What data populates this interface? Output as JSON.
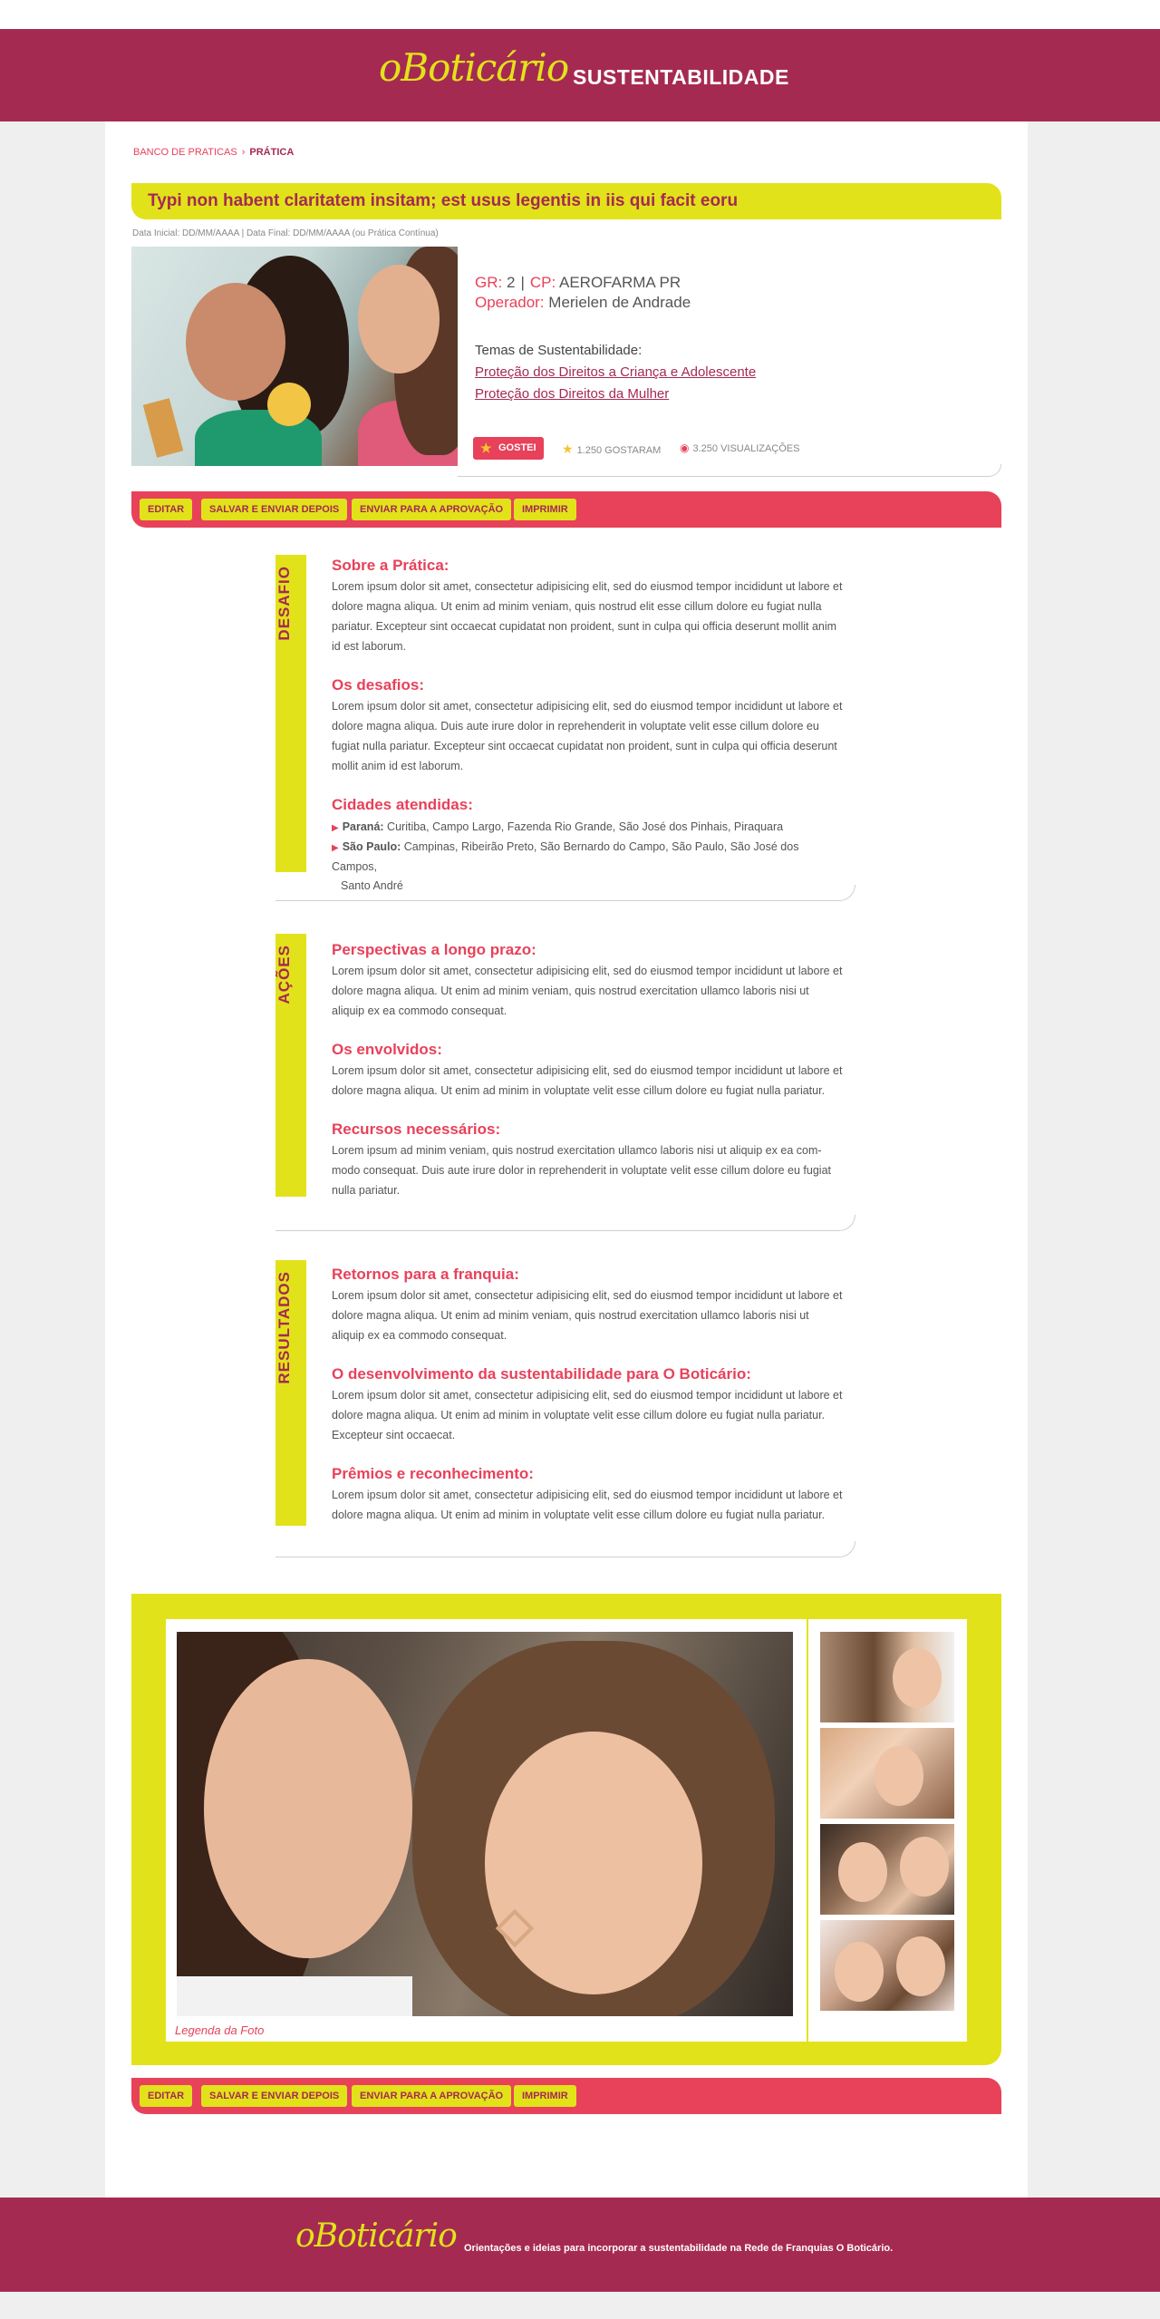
{
  "header": {
    "logo": "oBoticário",
    "title": "SUSTENTABILIDADE"
  },
  "breadcrumb": {
    "root": "BANCO DE PRATICAS",
    "separator": "›",
    "current": "PRÁTICA"
  },
  "practice": {
    "title": "Typi non habent claritatem insitam; est usus legentis in iis qui facit eoru",
    "dates": "Data Inicial: DD/MM/AAAA   |   Data Final: DD/MM/AAAA (ou Prática Contínua)",
    "gr_label": "GR:",
    "gr_value": "2",
    "cp_label": "CP:",
    "cp_value": "AEROFARMA PR",
    "operator_label": "Operador:",
    "operator_value": "Merielen de Andrade",
    "themes_title": "Temas de Sustentabilidade:",
    "themes": [
      "Proteção dos Direitos a Criança e Adolescente",
      "Proteção dos Direitos da Mulher"
    ],
    "like_button": "GOSTEI",
    "likes": "1.250 GOSTARAM",
    "views": "3.250 VISUALIZAÇÕES"
  },
  "actions": {
    "edit": "EDITAR",
    "save": "SALVAR E ENVIAR DEPOIS",
    "send": "ENVIAR PARA A APROVAÇÃO",
    "print": "IMPRIMIR"
  },
  "desafio": {
    "tab": "DESAFIO",
    "h1": "Sobre a Prática:",
    "p1": "Lorem ipsum dolor sit amet, consectetur adipisicing elit, sed do eiusmod tempor incididunt ut labore et dolore magna aliqua. Ut enim ad minim veniam, quis nostrud elit esse cillum dolore eu fugiat nulla pariatur. Excepteur sint occaecat cupidatat non proident, sunt in culpa qui officia deserunt mollit anim id est laborum.",
    "h2": "Os desafios:",
    "p2": "Lorem ipsum dolor sit amet, consectetur adipisicing elit, sed do eiusmod tempor incididunt ut labore et dolore magna aliqua. Duis aute irure dolor in reprehenderit in voluptate velit esse cillum dolore eu fugiat nulla pariatur. Excepteur sint occaecat cupidatat non proident, sunt in culpa qui officia deserunt mollit anim id est laborum.",
    "h3": "Cidades atendidas:",
    "city1_state": "Paraná:",
    "city1_list": "Curitiba, Campo Largo, Fazenda Rio Grande, São José dos Pinhais, Piraquara",
    "city2_state": "São Paulo:",
    "city2_list": "Campinas, Ribeirão Preto, São Bernardo do Campo, São Paulo, São José dos Campos,",
    "city2_cont": "Santo André"
  },
  "acoes": {
    "tab": "AÇÕES",
    "h1": "Perspectivas a longo prazo:",
    "p1": "Lorem ipsum dolor sit amet, consectetur adipisicing elit, sed do eiusmod tempor incididunt ut labore et dolore magna aliqua. Ut enim ad minim veniam, quis nostrud exercitation ullamco laboris nisi ut aliquip ex ea commodo consequat.",
    "h2": "Os envolvidos:",
    "p2": "Lorem ipsum dolor sit amet, consectetur adipisicing elit, sed do eiusmod tempor incididunt ut labore et dolore magna aliqua. Ut enim ad minim in voluptate velit esse cillum dolore eu fugiat nulla pariatur.",
    "h3": "Recursos necessários:",
    "p3": "Lorem ipsum ad minim veniam, quis nostrud exercitation ullamco laboris nisi ut aliquip ex ea com-modo consequat. Duis aute irure dolor in reprehenderit in voluptate velit esse cillum dolore eu fugiat nulla pariatur."
  },
  "resultados": {
    "tab": "RESULTADOS",
    "h1": "Retornos para a franquia:",
    "p1": "Lorem ipsum dolor sit amet, consectetur adipisicing elit, sed do eiusmod tempor incididunt ut labore et dolore magna aliqua. Ut enim ad minim veniam, quis nostrud exercitation ullamco laboris nisi ut aliquip ex ea commodo consequat.",
    "h2": "O desenvolvimento da sustentabilidade para O Boticário:",
    "p2": "Lorem ipsum dolor sit amet, consectetur adipisicing elit, sed do eiusmod tempor incididunt ut labore et dolore magna aliqua. Ut enim ad minim in voluptate velit esse cillum dolore eu fugiat nulla pariatur. Excepteur sint occaecat.",
    "h3": "Prêmios e reconhecimento:",
    "p3": "Lorem ipsum dolor sit amet, consectetur adipisicing elit, sed do eiusmod tempor incididunt ut labore et dolore magna aliqua. Ut enim ad minim in voluptate velit esse cillum dolore eu fugiat nulla pariatur."
  },
  "gallery": {
    "caption": "Legenda da Foto"
  },
  "footer": {
    "logo": "oBoticário",
    "text": "Orientações e ideias para incorporar a sustentabilidade na Rede de Franquias O Boticário."
  },
  "colors": {
    "brand": "#a52a52",
    "accent": "#e8415a",
    "highlight": "#e2e21a"
  }
}
